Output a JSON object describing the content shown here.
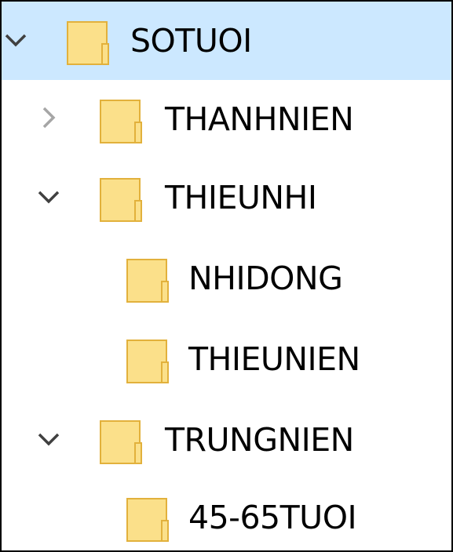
{
  "tree": {
    "items": [
      {
        "label": "SOTUOI",
        "state": "expanded",
        "selected": true
      },
      {
        "label": "THANHNIEN",
        "state": "collapsed",
        "selected": false
      },
      {
        "label": "THIEUNHI",
        "state": "expanded",
        "selected": false
      },
      {
        "label": "NHIDONG",
        "state": "none",
        "selected": false
      },
      {
        "label": "THIEUNIEN",
        "state": "none",
        "selected": false
      },
      {
        "label": "TRUNGNIEN",
        "state": "expanded",
        "selected": false
      },
      {
        "label": "45-65TUOI",
        "state": "none",
        "selected": false
      }
    ]
  },
  "colors": {
    "selection": "#cce8ff",
    "folder_fill": "#fbe08a",
    "folder_edge": "#e2b13c",
    "chevron_expanded": "#404040",
    "chevron_collapsed": "#a6a6a6"
  },
  "icons": {
    "folder": "folder-icon",
    "expanded": "chevron-down-icon",
    "collapsed": "chevron-right-icon"
  }
}
